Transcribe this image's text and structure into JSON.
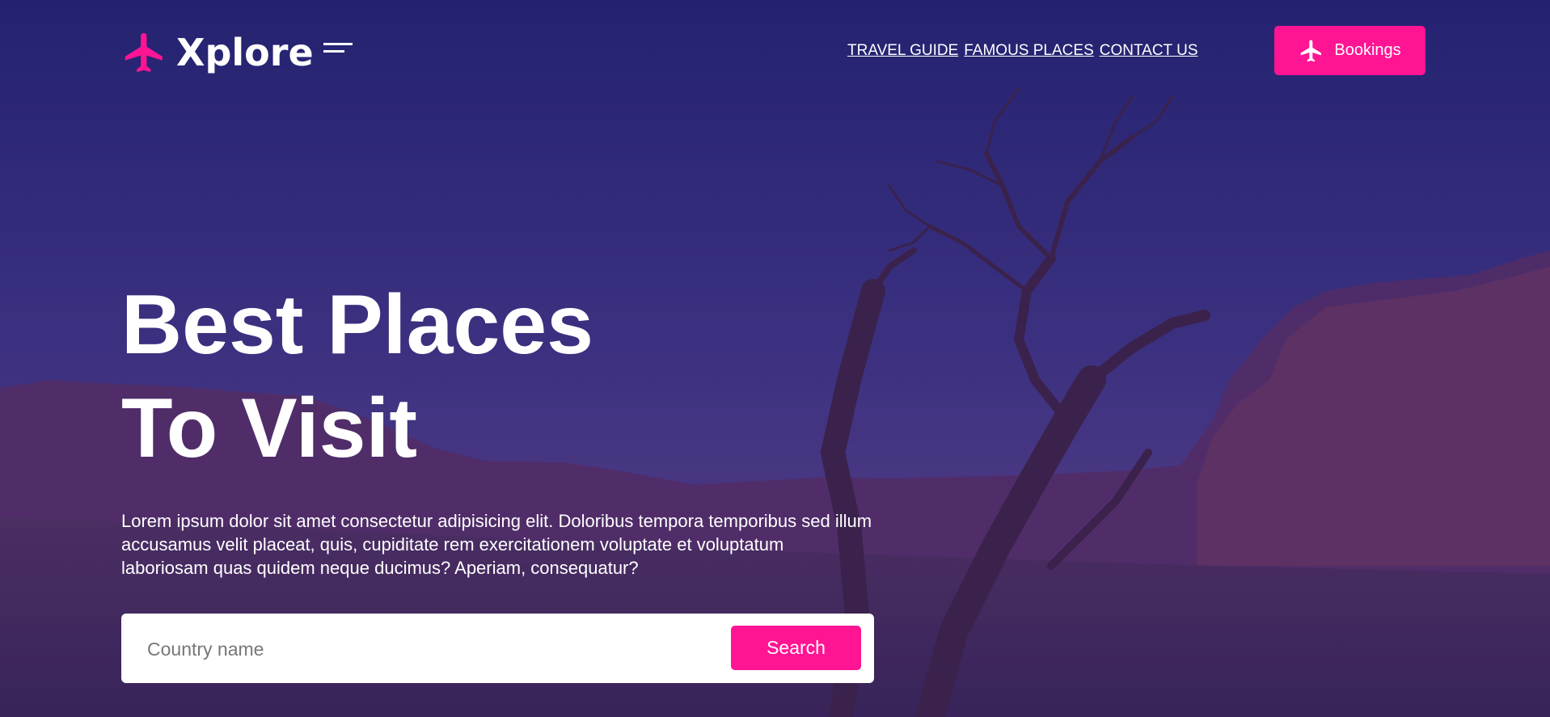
{
  "brand": {
    "name": "Xplore",
    "accent_color": "#ff1493"
  },
  "nav": {
    "links": [
      {
        "label": "TRAVEL GUIDE"
      },
      {
        "label": "FAMOUS PLACES"
      },
      {
        "label": "CONTACT US"
      }
    ],
    "cta": {
      "label": "Bookings",
      "icon": "plane-icon"
    }
  },
  "hero": {
    "title_line1": "Best Places",
    "title_line2": "To Visit",
    "description": "Lorem ipsum dolor sit amet consectetur adipisicing elit. Doloribus tempora temporibus sed illum accusamus velit placeat, quis, cupiditate rem exercitationem voluptate et voluptatum laboriosam quas quidem neque ducimus? Aperiam, consequatur?",
    "search": {
      "placeholder": "Country name",
      "value": "",
      "button_label": "Search"
    }
  },
  "background": {
    "scene": "desert canyon with dead tree at dusk",
    "overlay_color": "#2b2777"
  }
}
